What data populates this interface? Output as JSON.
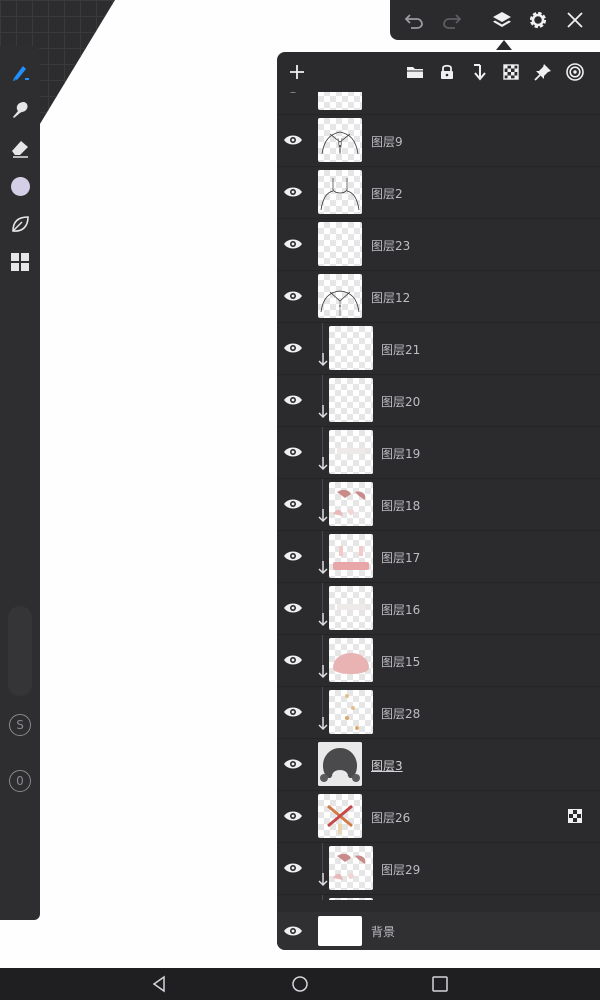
{
  "app": {
    "accent": "#1e90ff",
    "panel_bg": "#2b2b2d",
    "color_swatch": "#d4cfe6"
  },
  "toolbar": {
    "tools": [
      {
        "name": "brush-icon"
      },
      {
        "name": "smudge-icon"
      },
      {
        "name": "eraser-icon"
      },
      {
        "name": "color-swatch"
      },
      {
        "name": "leaf-icon"
      },
      {
        "name": "grid-icon"
      }
    ],
    "bottom_buttons": [
      "S",
      "0"
    ]
  },
  "topbar": {
    "icons": [
      "undo-icon",
      "redo-icon",
      "layers-icon",
      "settings-icon",
      "close-icon"
    ]
  },
  "layers_panel": {
    "head_icons": [
      "add-icon",
      "folder-icon",
      "lock-icon",
      "merge-down-icon",
      "mask-icon",
      "pin-icon",
      "blend-icon"
    ],
    "layers": [
      {
        "name": "",
        "clipped": false,
        "thumb": "partial"
      },
      {
        "name": "图层9",
        "clipped": false,
        "thumb": "lineart-collar"
      },
      {
        "name": "图层2",
        "clipped": false,
        "thumb": "lineart-neck"
      },
      {
        "name": "图层23",
        "clipped": false,
        "thumb": "empty"
      },
      {
        "name": "图层12",
        "clipped": false,
        "thumb": "lineart-shirt"
      },
      {
        "name": "图层21",
        "clipped": true,
        "thumb": "empty"
      },
      {
        "name": "图层20",
        "clipped": true,
        "thumb": "empty"
      },
      {
        "name": "图层19",
        "clipped": true,
        "thumb": "faint"
      },
      {
        "name": "图层18",
        "clipped": true,
        "thumb": "pink-shapes"
      },
      {
        "name": "图层17",
        "clipped": true,
        "thumb": "pink-band"
      },
      {
        "name": "图层16",
        "clipped": true,
        "thumb": "faint"
      },
      {
        "name": "图层15",
        "clipped": true,
        "thumb": "pink-blob"
      },
      {
        "name": "图层28",
        "clipped": true,
        "thumb": "dots"
      },
      {
        "name": "图层3",
        "clipped": false,
        "thumb": "hair",
        "active": true
      },
      {
        "name": "图层26",
        "clipped": false,
        "thumb": "cross",
        "mask": true
      },
      {
        "name": "图层29",
        "clipped": true,
        "thumb": "pink-shapes"
      },
      {
        "name": "",
        "clipped": true,
        "thumb": "partial"
      }
    ],
    "background": {
      "name": "背景"
    }
  },
  "navbar": {
    "buttons": [
      "back-icon",
      "home-icon",
      "recents-icon"
    ]
  }
}
